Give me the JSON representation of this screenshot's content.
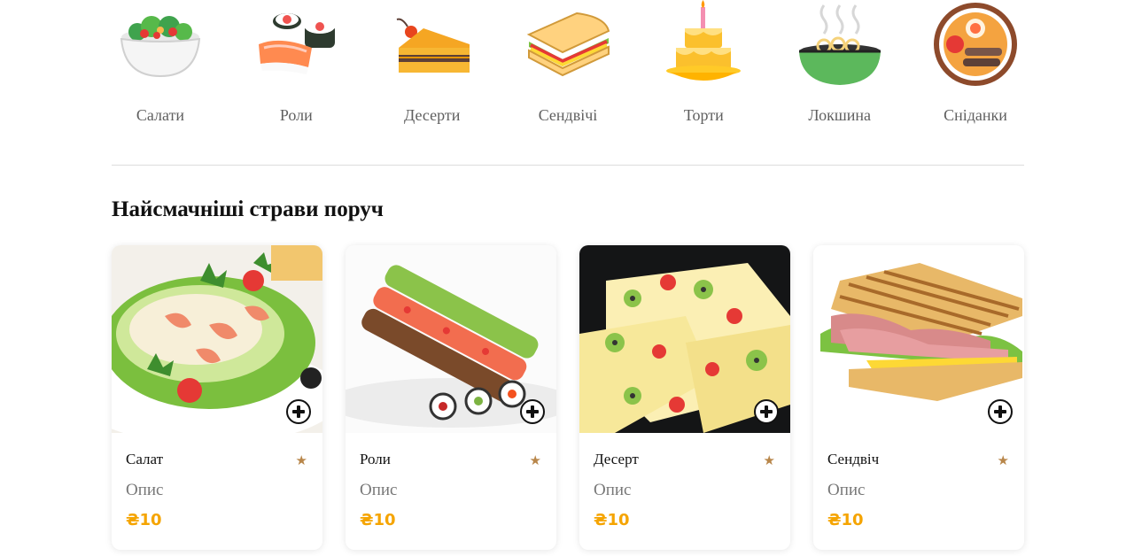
{
  "categories": [
    {
      "label": "Салати",
      "icon": "salad-bowl-icon"
    },
    {
      "label": "Роли",
      "icon": "sushi-roll-icon"
    },
    {
      "label": "Десерти",
      "icon": "cake-slice-icon"
    },
    {
      "label": "Сендвічі",
      "icon": "sandwich-icon"
    },
    {
      "label": "Торти",
      "icon": "birthday-cake-icon"
    },
    {
      "label": "Локшина",
      "icon": "noodle-bowl-icon"
    },
    {
      "label": "Сніданки",
      "icon": "breakfast-plate-icon"
    }
  ],
  "section_title": "Найсмачніші страви поруч",
  "products": [
    {
      "name": "Салат",
      "description": "Опис",
      "price": "₴10",
      "image": "caesar-salad-with-shrimp"
    },
    {
      "name": "Роли",
      "description": "Опис",
      "price": "₴10",
      "image": "sushi-rolls"
    },
    {
      "name": "Десерт",
      "description": "Опис",
      "price": "₴10",
      "image": "fruit-jelly-dessert"
    },
    {
      "name": "Сендвіч",
      "description": "Опис",
      "price": "₴10",
      "image": "ham-sandwich"
    }
  ],
  "colors": {
    "price": "#f5a400",
    "star": "#b8864a",
    "divider": "#dcdcdc"
  }
}
